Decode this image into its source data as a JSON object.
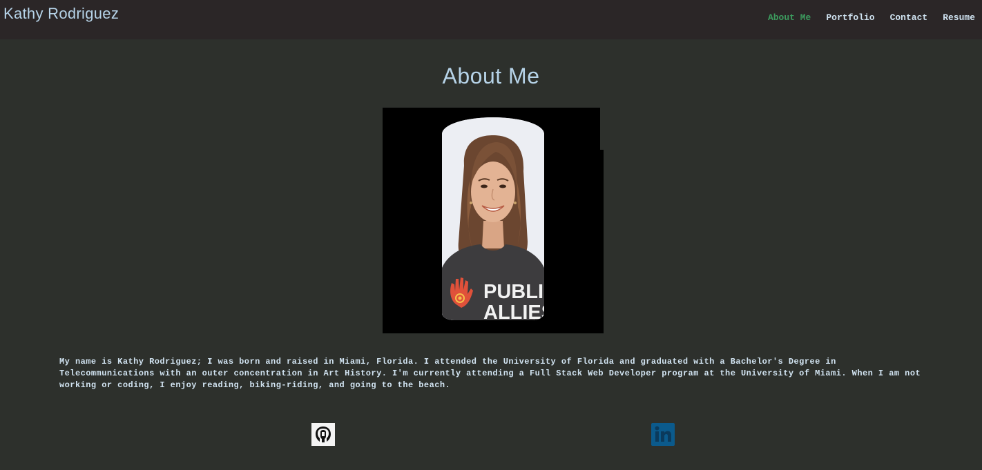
{
  "header": {
    "brand": "Kathy Rodriguez",
    "nav": [
      {
        "label": "About Me",
        "active": true
      },
      {
        "label": "Portfolio",
        "active": false
      },
      {
        "label": "Contact",
        "active": false
      },
      {
        "label": "Resume",
        "active": false
      }
    ]
  },
  "main": {
    "title": "About Me",
    "photo": {
      "shirt_text_line1": "PUBLIC",
      "shirt_text_line2": "ALLIES"
    },
    "bio": "My name is Kathy Rodriguez; I was born and raised in Miami, Florida. I attended the University of Florida and graduated with a Bachelor's Degree in Telecommunications with an outer concentration in Art History. I'm currently attending a Full Stack Web Developer program at the University of Miami. When I am not working or coding, I enjoy reading, biking-riding, and going to the beach."
  },
  "social": [
    {
      "icon": "github-icon"
    },
    {
      "icon": "linkedin-icon"
    }
  ],
  "colors": {
    "background": "#2d302c",
    "header_bg": "#2b2627",
    "brand_text": "#b6d3e8",
    "nav_text": "#cfe2f0",
    "nav_active": "#3c9b5e",
    "linkedin_blue": "#0b5a8c"
  }
}
